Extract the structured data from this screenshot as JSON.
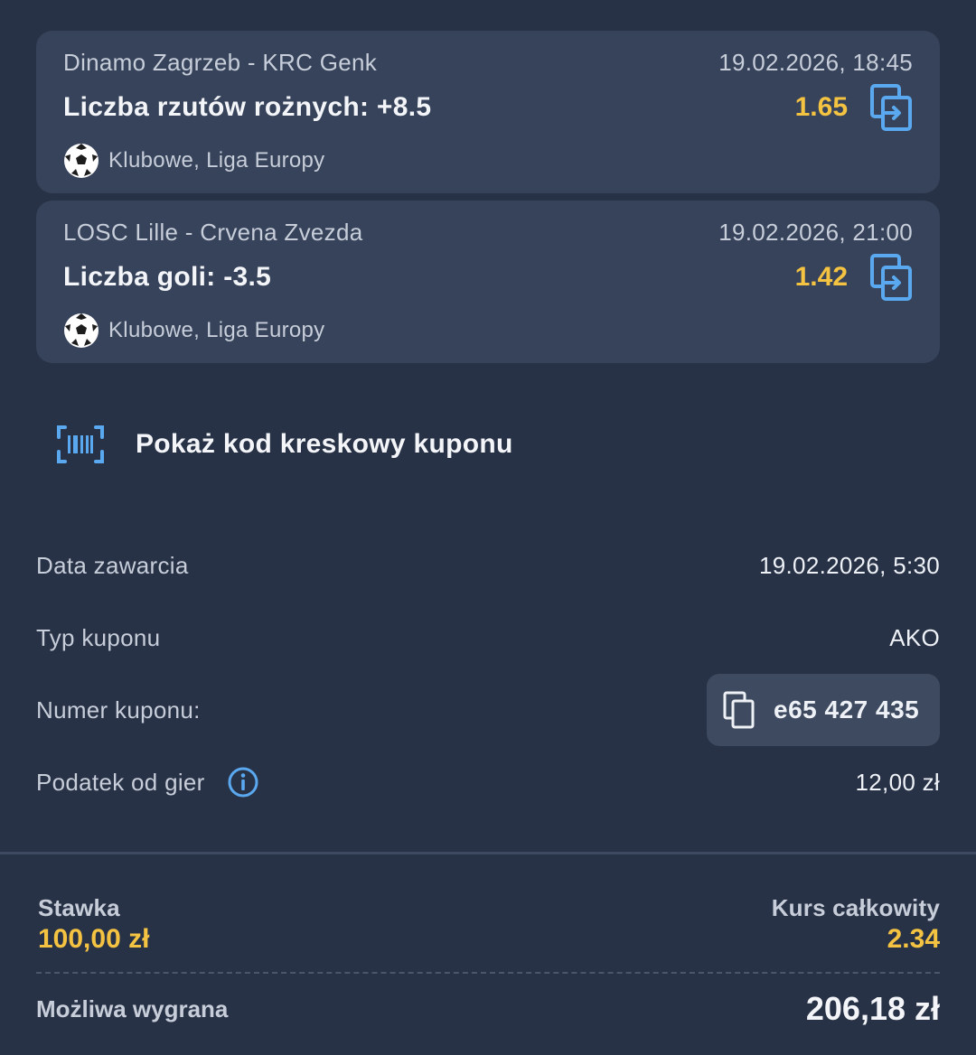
{
  "bets": [
    {
      "teams": "Dinamo Zagrzeb - KRC Genk",
      "date": "19.02.2026, 18:45",
      "market": "Liczba rzutów rożnych: +8.5",
      "odds": "1.65",
      "league": "Klubowe, Liga Europy",
      "sport_icon": "soccer-ball-icon",
      "action_icon": "copy-bet-icon"
    },
    {
      "teams": "LOSC Lille - Crvena Zvezda",
      "date": "19.02.2026, 21:00",
      "market": "Liczba goli: -3.5",
      "odds": "1.42",
      "league": "Klubowe, Liga Europy",
      "sport_icon": "soccer-ball-icon",
      "action_icon": "copy-bet-icon"
    }
  ],
  "barcode": {
    "label": "Pokaż kod kreskowy kuponu",
    "icon": "barcode-scan-icon"
  },
  "details": {
    "date_label": "Data zawarcia",
    "date_value": "19.02.2026, 5:30",
    "type_label": "Typ kuponu",
    "type_value": "AKO",
    "number_label": "Numer kuponu:",
    "number_value": "e65 427 435",
    "tax_label": "Podatek od gier",
    "tax_value": "12,00 zł"
  },
  "summary": {
    "stake_label": "Stawka",
    "stake_value": "100,00 zł",
    "total_odds_label": "Kurs całkowity",
    "total_odds_value": "2.34",
    "win_label": "Możliwa wygrana",
    "win_value": "206,18 zł"
  },
  "colors": {
    "background": "#283246",
    "card": "#36435a",
    "accent_odds": "#f5c342",
    "icon_blue": "#5aa9f0"
  }
}
